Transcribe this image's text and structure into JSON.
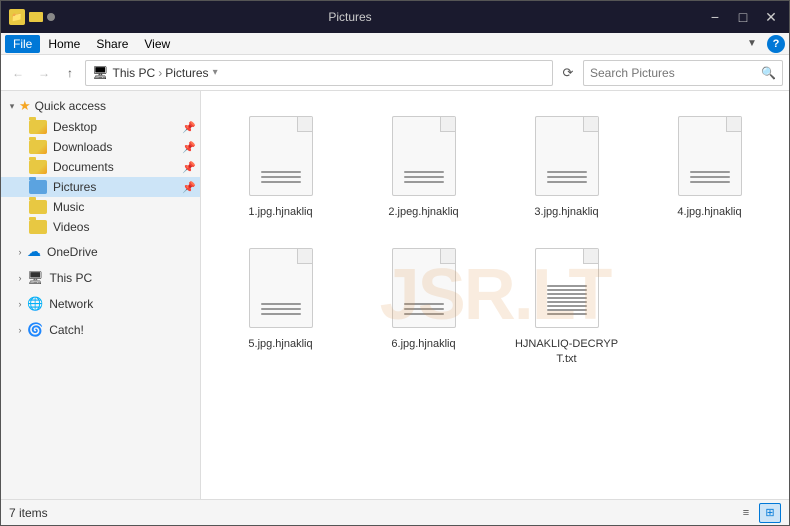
{
  "titleBar": {
    "title": "Pictures",
    "minimizeLabel": "−",
    "maximizeLabel": "□",
    "closeLabel": "✕"
  },
  "menuBar": {
    "items": [
      {
        "label": "File",
        "active": true
      },
      {
        "label": "Home"
      },
      {
        "label": "Share"
      },
      {
        "label": "View"
      }
    ]
  },
  "addressBar": {
    "backLabel": "←",
    "forwardLabel": "→",
    "upLabel": "↑",
    "refreshLabel": "⟳",
    "pathParts": [
      "This PC",
      "Pictures"
    ],
    "searchPlaceholder": "Search Pictures"
  },
  "sidebar": {
    "quickAccess": {
      "label": "Quick access",
      "items": [
        {
          "label": "Desktop",
          "pinned": true
        },
        {
          "label": "Downloads",
          "pinned": true
        },
        {
          "label": "Documents",
          "pinned": true
        },
        {
          "label": "Pictures",
          "pinned": true,
          "active": true
        }
      ]
    },
    "extras": [
      {
        "label": "Music"
      },
      {
        "label": "Videos"
      }
    ],
    "groups": [
      {
        "label": "OneDrive",
        "icon": "cloud"
      },
      {
        "label": "This PC",
        "icon": "pc"
      },
      {
        "label": "Network",
        "icon": "network"
      },
      {
        "label": "Catch!",
        "icon": "catch"
      }
    ]
  },
  "files": [
    {
      "name": "1.jpg.hjnakliq",
      "type": "doc"
    },
    {
      "name": "2.jpeg.hjnakliq",
      "type": "doc"
    },
    {
      "name": "3.jpg.hjnakliq",
      "type": "doc"
    },
    {
      "name": "4.jpg.hjnakliq",
      "type": "doc"
    },
    {
      "name": "5.jpg.hjnakliq",
      "type": "doc"
    },
    {
      "name": "6.jpg.hjnakliq",
      "type": "doc"
    },
    {
      "name": "HJNAKLIQ-DECRYPT.txt",
      "type": "txt"
    }
  ],
  "statusBar": {
    "itemCount": "7 items"
  }
}
